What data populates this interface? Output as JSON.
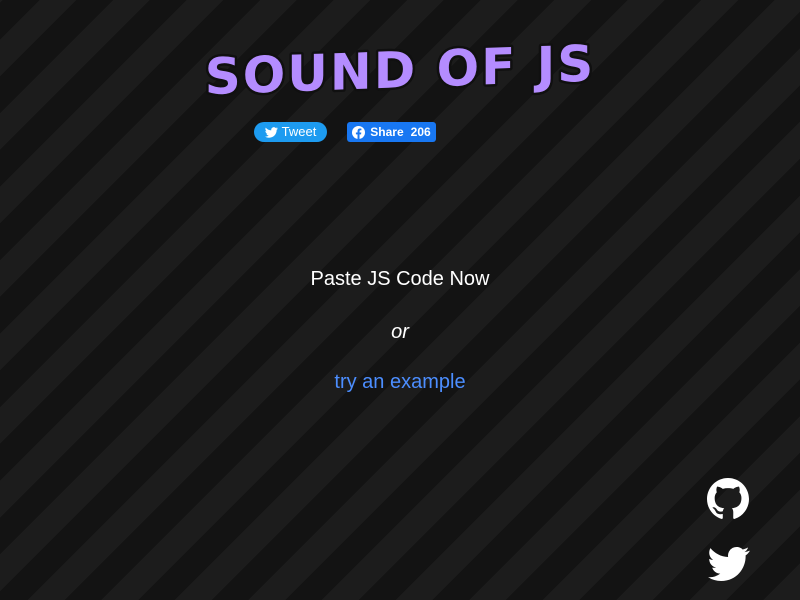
{
  "header": {
    "logo_text": "SOUND OF JS"
  },
  "social": {
    "tweet_label": "Tweet",
    "share_label": "Share",
    "share_count": "206"
  },
  "main": {
    "paste_prompt": "Paste JS Code Now",
    "or_text": "or",
    "example_link": "try an example"
  },
  "footer_icons": {
    "github": "github-icon",
    "twitter": "twitter-icon"
  },
  "colors": {
    "background": "#161616",
    "logo_fill": "#b48cff",
    "logo_outline": "#101010",
    "tweet_button": "#1d9bf0",
    "share_button": "#1877f2",
    "link": "#4c8eff",
    "text": "#ffffff"
  }
}
